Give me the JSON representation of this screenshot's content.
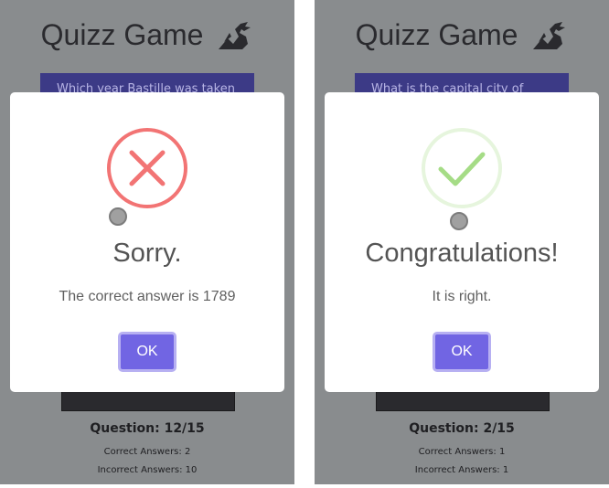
{
  "screens": [
    {
      "app_title": "Quizz Game",
      "question_partial": "Which year Bastille was taken",
      "question_counter": "Question: 12/15",
      "correct_answers": "Correct Answers: 2",
      "incorrect_answers": "Incorrect Answers: 10",
      "dialog": {
        "status": "error",
        "icon": "error-x-icon",
        "icon_color": "#f27474",
        "title": "Sorry.",
        "message": "The correct answer is 1789",
        "ok_label": "OK"
      }
    },
    {
      "app_title": "Quizz Game",
      "question_partial": "What is the capital city of",
      "question_counter": "Question: 2/15",
      "correct_answers": "Correct Answers: 1",
      "incorrect_answers": "Incorrect Answers: 1",
      "dialog": {
        "status": "success",
        "icon": "success-check-icon",
        "icon_color": "#a5dc86",
        "title": "Congratulations!",
        "message": "It is right.",
        "ok_label": "OK"
      }
    }
  ],
  "colors": {
    "overlay_background": "#898c8e",
    "question_box": "#3c3a86",
    "ok_button": "#7165e3",
    "ok_button_border": "#b7b0f2"
  }
}
